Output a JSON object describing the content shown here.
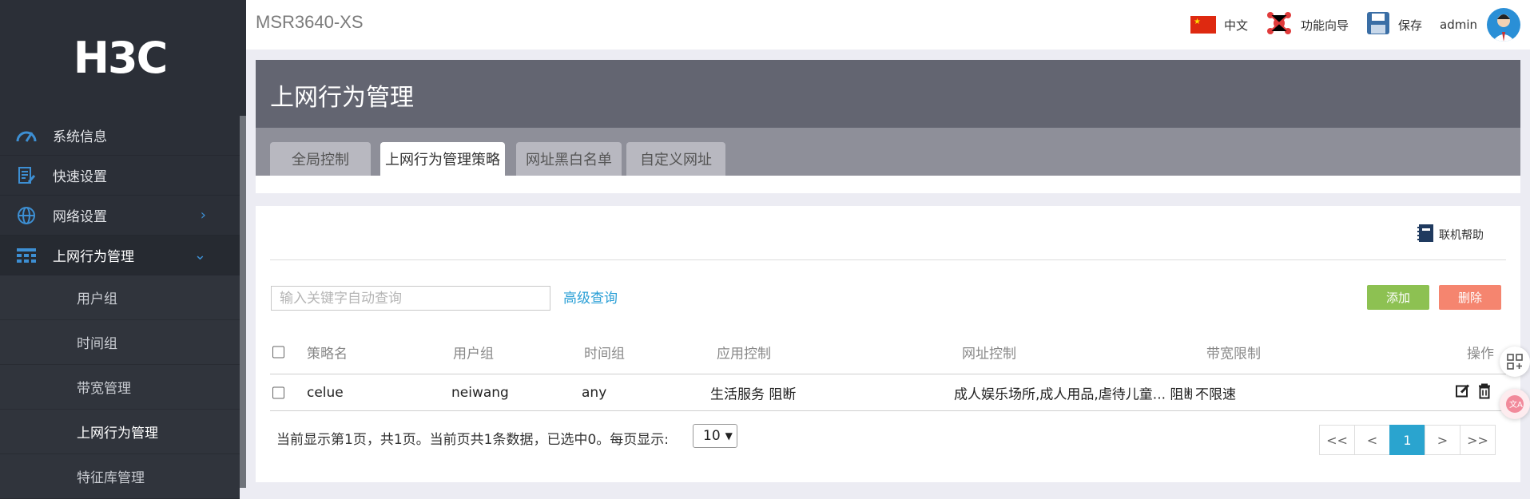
{
  "brand": {
    "logo": "H3C"
  },
  "topbar": {
    "device": "MSR3640-XS",
    "lang": "中文",
    "wizard": "功能向导",
    "save": "保存",
    "user": "admin"
  },
  "sidebar": {
    "items": [
      {
        "label": "系统信息",
        "icon": "speedometer-icon"
      },
      {
        "label": "快速设置",
        "icon": "quick-setup-icon"
      },
      {
        "label": "网络设置",
        "icon": "globe-icon"
      },
      {
        "label": "上网行为管理",
        "icon": "table-icon"
      }
    ],
    "sub_items": [
      "用户组",
      "时间组",
      "带宽管理",
      "上网行为管理",
      "特征库管理"
    ]
  },
  "page": {
    "title": "上网行为管理",
    "tabs": [
      "全局控制",
      "上网行为管理策略",
      "网址黑白名单",
      "自定义网址"
    ]
  },
  "toolbar": {
    "help": "联机帮助",
    "search_placeholder": "输入关键字自动查询",
    "advanced": "高级查询",
    "add": "添加",
    "delete": "删除"
  },
  "table": {
    "columns": [
      "策略名",
      "用户组",
      "时间组",
      "应用控制",
      "网址控制",
      "带宽限制",
      "操作"
    ],
    "rows": [
      {
        "name": "celue",
        "group": "neiwang",
        "time": "any",
        "app": "生活服务 阻断",
        "url": "成人娱乐场所,成人用品,虐待儿童... 阻断",
        "bw": "不限速"
      }
    ]
  },
  "pager": {
    "summary": "当前显示第1页，共1页。当前页共1条数据，已选中0。每页显示:",
    "per_page": "10",
    "buttons": [
      "<<",
      "<",
      "1",
      ">",
      ">>"
    ]
  }
}
